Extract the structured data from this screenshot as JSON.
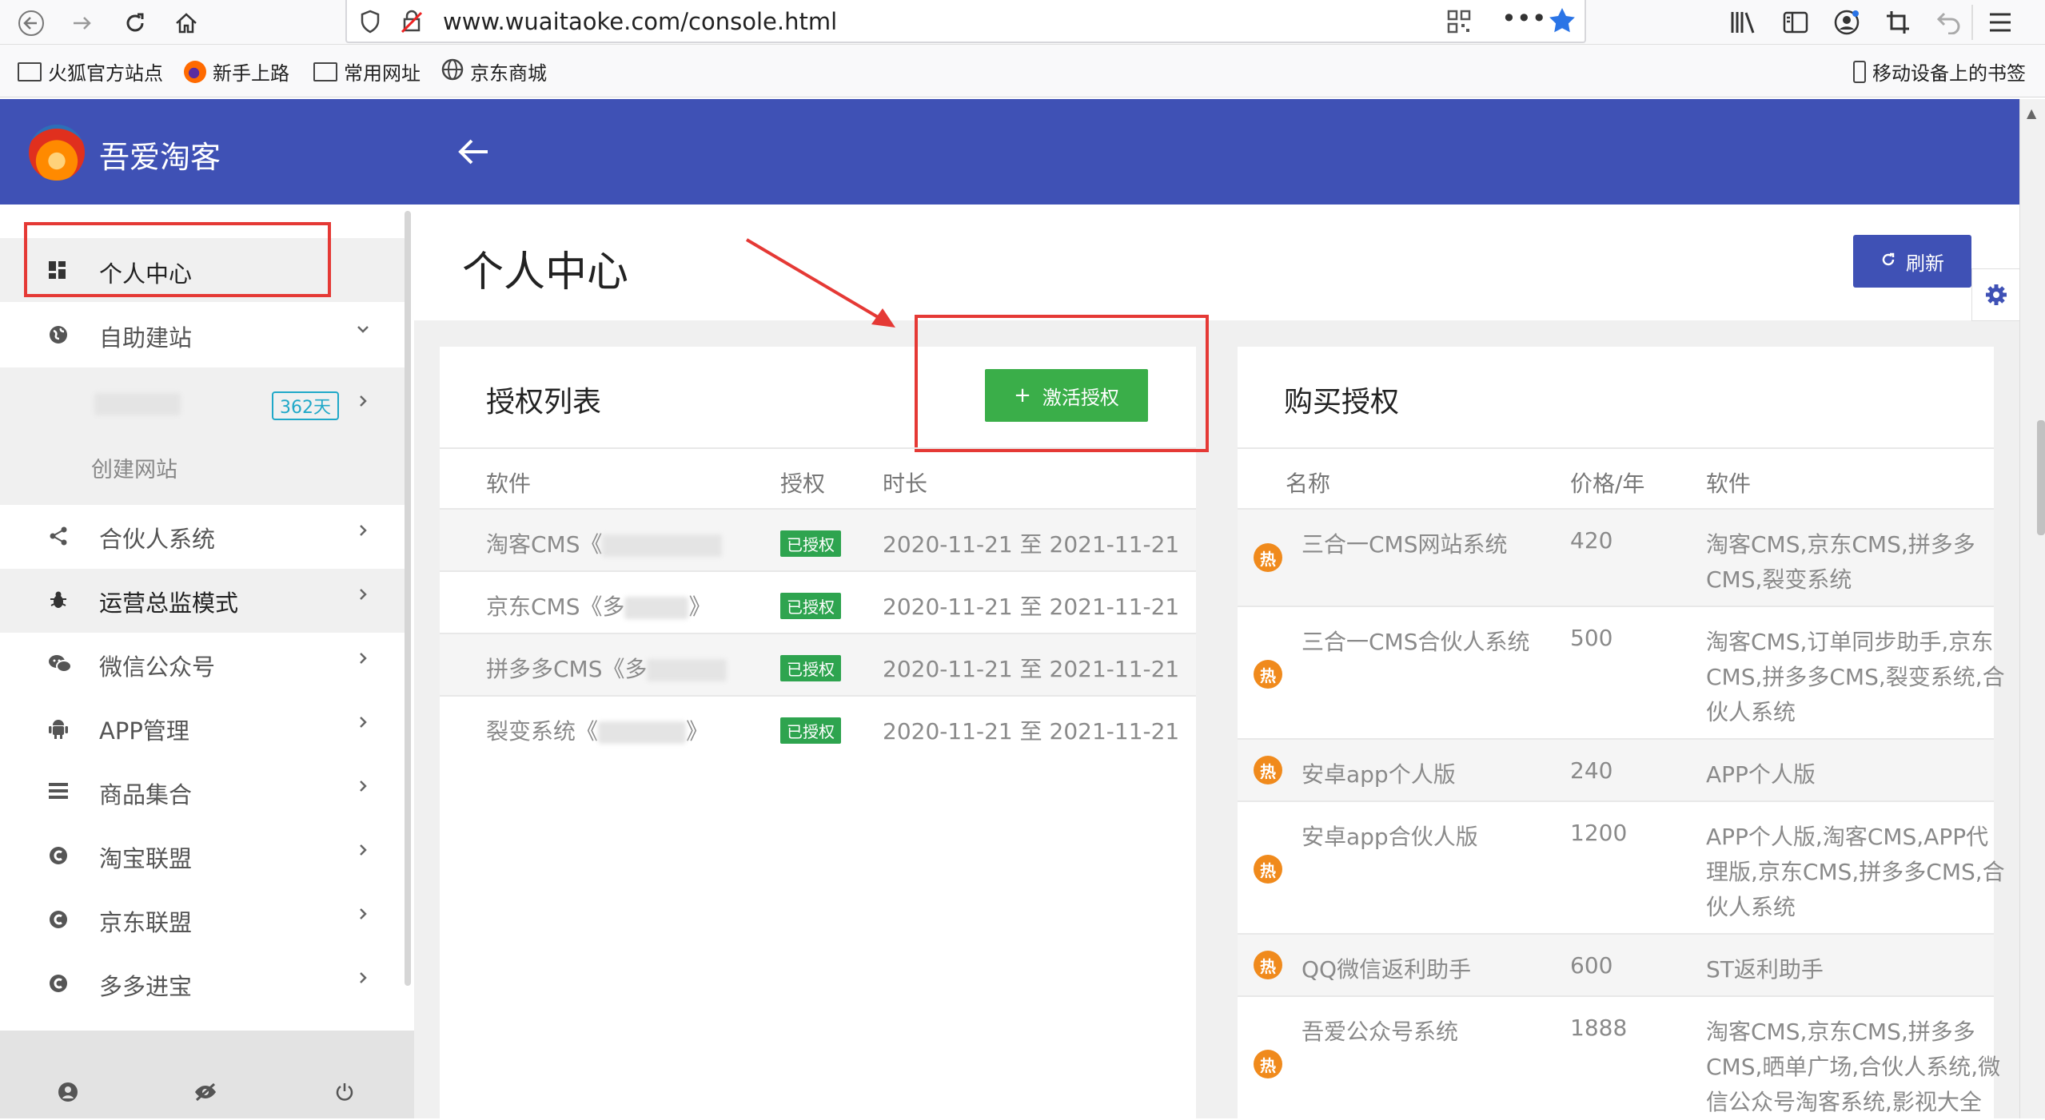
{
  "browser": {
    "url": "www.wuaitaoke.com/console.html",
    "bookmarks": [
      "火狐官方站点",
      "新手上路",
      "常用网址",
      "京东商城"
    ],
    "mobile_bookmarks": "移动设备上的书签"
  },
  "app": {
    "title": "吾爱淘客"
  },
  "sidebar": {
    "items": [
      {
        "label": "个人中心",
        "icon": "dashboard-icon"
      },
      {
        "label": "自助建站",
        "icon": "globe-icon"
      },
      {
        "label": "合伙人系统",
        "icon": "share-icon"
      },
      {
        "label": "运营总监模式",
        "icon": "bug-icon"
      },
      {
        "label": "微信公众号",
        "icon": "wechat-icon"
      },
      {
        "label": "APP管理",
        "icon": "android-icon"
      },
      {
        "label": "商品集合",
        "icon": "list-icon"
      },
      {
        "label": "淘宝联盟",
        "icon": "coin-icon"
      },
      {
        "label": "京东联盟",
        "icon": "coin-icon"
      },
      {
        "label": "多多进宝",
        "icon": "coin-icon"
      }
    ],
    "site_sub": {
      "badge": "362天",
      "create_label": "创建网站"
    }
  },
  "page": {
    "title": "个人中心",
    "refresh_label": "刷新"
  },
  "auth_list": {
    "title": "授权列表",
    "activate_label": "激活授权",
    "headers": [
      "软件",
      "授权",
      "时长"
    ],
    "rows": [
      {
        "software": "淘客CMS《",
        "status": "已授权",
        "duration": "2020-11-21 至 2021-11-21"
      },
      {
        "software": "京东CMS《多",
        "suffix": "》",
        "status": "已授权",
        "duration": "2020-11-21 至 2021-11-21"
      },
      {
        "software": "拼多多CMS《多",
        "status": "已授权",
        "duration": "2020-11-21 至 2021-11-21"
      },
      {
        "software": "裂变系统《",
        "suffix": "》",
        "status": "已授权",
        "duration": "2020-11-21 至 2021-11-21"
      }
    ]
  },
  "buy": {
    "title": "购买授权",
    "headers": [
      "名称",
      "价格/年",
      "软件"
    ],
    "hot_label": "热",
    "rows": [
      {
        "name": "三合一CMS网站系统",
        "price": "420",
        "software": [
          "淘客CMS,京东CMS,拼多多",
          "CMS,裂变系统"
        ]
      },
      {
        "name": "三合一CMS合伙人系统",
        "price": "500",
        "software": [
          "淘客CMS,订单同步助手,京东",
          "CMS,拼多多CMS,裂变系统,合",
          "伙人系统"
        ]
      },
      {
        "name": "安卓app个人版",
        "price": "240",
        "software": [
          "APP个人版"
        ]
      },
      {
        "name": "安卓app合伙人版",
        "price": "1200",
        "software": [
          "APP个人版,淘客CMS,APP代",
          "理版,京东CMS,拼多多CMS,合",
          "伙人系统"
        ]
      },
      {
        "name": "QQ微信返利助手",
        "price": "600",
        "software": [
          "ST返利助手"
        ]
      },
      {
        "name": "吾爱公众号系统",
        "price": "1888",
        "software": [
          "淘客CMS,京东CMS,拼多多",
          "CMS,晒单广场,合伙人系统,微",
          "信公众号淘客系统,影视大全"
        ]
      }
    ]
  },
  "colors": {
    "primary": "#3f51b5",
    "success": "#3aae49",
    "highlight": "#e53935",
    "hot": "#f08a1c"
  }
}
